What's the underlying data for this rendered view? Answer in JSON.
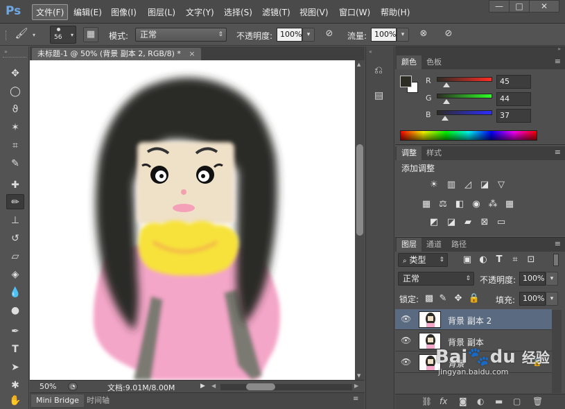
{
  "app": {
    "logo": "Ps"
  },
  "menu": [
    "文件(F)",
    "编辑(E)",
    "图像(I)",
    "图层(L)",
    "文字(Y)",
    "选择(S)",
    "滤镜(T)",
    "视图(V)",
    "窗口(W)",
    "帮助(H)"
  ],
  "window_controls": {
    "minimize": "—",
    "maximize": "□",
    "close": "✕"
  },
  "options": {
    "brush_size": "56",
    "mode_label": "模式:",
    "mode_value": "正常",
    "opacity_label": "不透明度:",
    "opacity_value": "100%",
    "flow_label": "流量:",
    "flow_value": "100%"
  },
  "document": {
    "tab_title": "未标题-1 @ 50% (背景 副本 2, RGB/8) *",
    "zoom": "50%",
    "doc_size": "文档:9.01M/8.00M"
  },
  "bottom_tabs": [
    "Mini Bridge",
    "时间轴"
  ],
  "color_panel": {
    "tabs": [
      "颜色",
      "色板"
    ],
    "r_label": "R",
    "r_value": "45",
    "g_label": "G",
    "g_value": "44",
    "b_label": "B",
    "b_value": "37",
    "r": 45,
    "g": 44,
    "b": 37,
    "foreground": "#2d2c25"
  },
  "adjust_panel": {
    "tabs": [
      "调整",
      "样式"
    ],
    "title": "添加调整"
  },
  "layers_panel": {
    "tabs": [
      "图层",
      "通道",
      "路径"
    ],
    "filter_kind": "类型",
    "blend_mode": "正常",
    "opacity_label": "不透明度:",
    "opacity_value": "100%",
    "lock_label": "锁定:",
    "fill_label": "填充:",
    "fill_value": "100%",
    "layers": [
      {
        "name": "背景 副本 2",
        "selected": true
      },
      {
        "name": "背景 副本",
        "selected": false
      },
      {
        "name": "背景",
        "selected": false
      }
    ]
  },
  "watermark": {
    "brand": "Bai",
    "paw": "du",
    "suffix": "经验",
    "url": "jingyan.baidu.com"
  },
  "colors": {
    "accent": "#6fa8e6",
    "selected_layer": "#5a6a80",
    "panel": "#535353"
  }
}
